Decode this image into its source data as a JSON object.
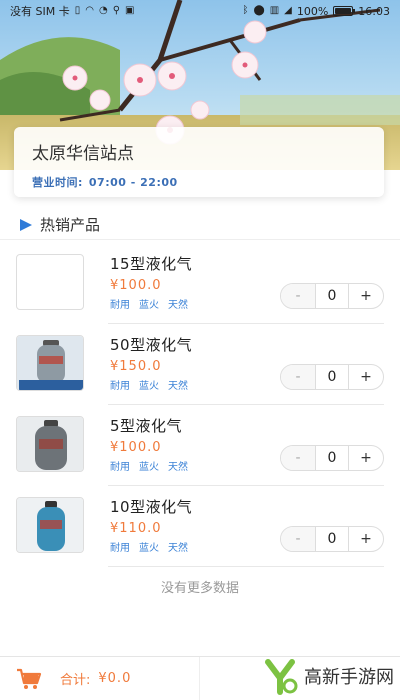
{
  "status_bar": {
    "left_text": "没有 SIM 卡",
    "battery": "100%",
    "battery_level": 1.0,
    "time": "16:03"
  },
  "store": {
    "name": "太原华信站点",
    "hours_label": "营业时间:",
    "hours_value": "07:00 - 22:00"
  },
  "section": {
    "title": "热销产品"
  },
  "products": [
    {
      "name": "15型液化气",
      "price": "¥100.0",
      "tags": [
        "耐用",
        "蓝火",
        "天然"
      ],
      "quantity": "0",
      "minus": "-",
      "plus": "+"
    },
    {
      "name": "50型液化气",
      "price": "¥150.0",
      "tags": [
        "耐用",
        "蓝火",
        "天然"
      ],
      "quantity": "0",
      "minus": "-",
      "plus": "+"
    },
    {
      "name": "5型液化气",
      "price": "¥100.0",
      "tags": [
        "耐用",
        "蓝火",
        "天然"
      ],
      "quantity": "0",
      "minus": "-",
      "plus": "+"
    },
    {
      "name": "10型液化气",
      "price": "¥110.0",
      "tags": [
        "耐用",
        "蓝火",
        "天然"
      ],
      "quantity": "0",
      "minus": "-",
      "plus": "+"
    }
  ],
  "list_footer": "没有更多数据",
  "cart": {
    "total_label": "合计:",
    "total_value": "¥0.0"
  },
  "watermark": {
    "text": "高新手游网"
  },
  "colors": {
    "accent_blue": "#2f7bd8",
    "price_orange": "#f07a3b",
    "tag_blue": "#3b82d6"
  }
}
